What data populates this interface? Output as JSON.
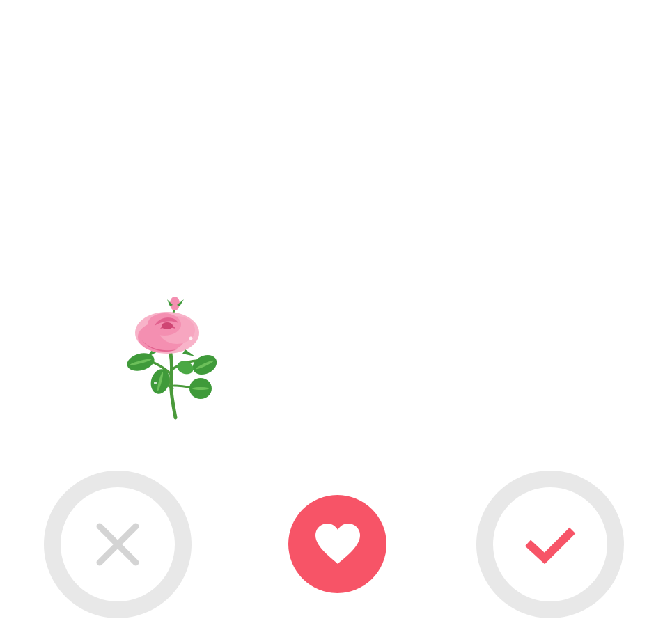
{
  "screen": {
    "background": "#ffffff"
  },
  "illustration": {
    "icon": "pink-rose-with-leaves",
    "petal_color": "#f48fb1",
    "petal_shade": "#e2628f",
    "leaf_color": "#3f9a3a",
    "stem_color": "#4a9a3a"
  },
  "actions": {
    "dislike": {
      "icon": "close-icon",
      "ring_color": "#e8e8e8",
      "icon_color": "#d4d4d4"
    },
    "favorite": {
      "icon": "heart-icon",
      "fill_color": "#f75467",
      "icon_color": "#ffffff"
    },
    "like": {
      "icon": "check-icon",
      "ring_color": "#e8e8e8",
      "icon_color": "#f75467"
    }
  }
}
